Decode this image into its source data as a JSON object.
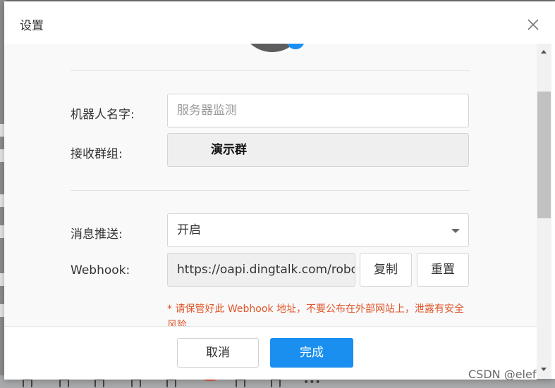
{
  "dialog": {
    "title": "设置",
    "close_icon": "close-icon",
    "robot_name": {
      "label": "机器人名字:",
      "placeholder": "服务器监测"
    },
    "group": {
      "label": "接收群组:",
      "value": "演示群"
    },
    "push": {
      "label": "消息推送:",
      "value": "开启"
    },
    "webhook": {
      "label": "Webhook:",
      "value": "https://oapi.dingtalk.com/robot/send",
      "copy_label": "复制",
      "reset_label": "重置"
    },
    "warning": "* 请保管好此 Webhook 地址，不要公布在外部网站上，泄露有安全风险",
    "footer": {
      "cancel_label": "取消",
      "ok_label": "完成"
    }
  },
  "colors": {
    "primary": "#1a8ff0",
    "warning": "#e0552a"
  },
  "watermark": "CSDN @elef"
}
